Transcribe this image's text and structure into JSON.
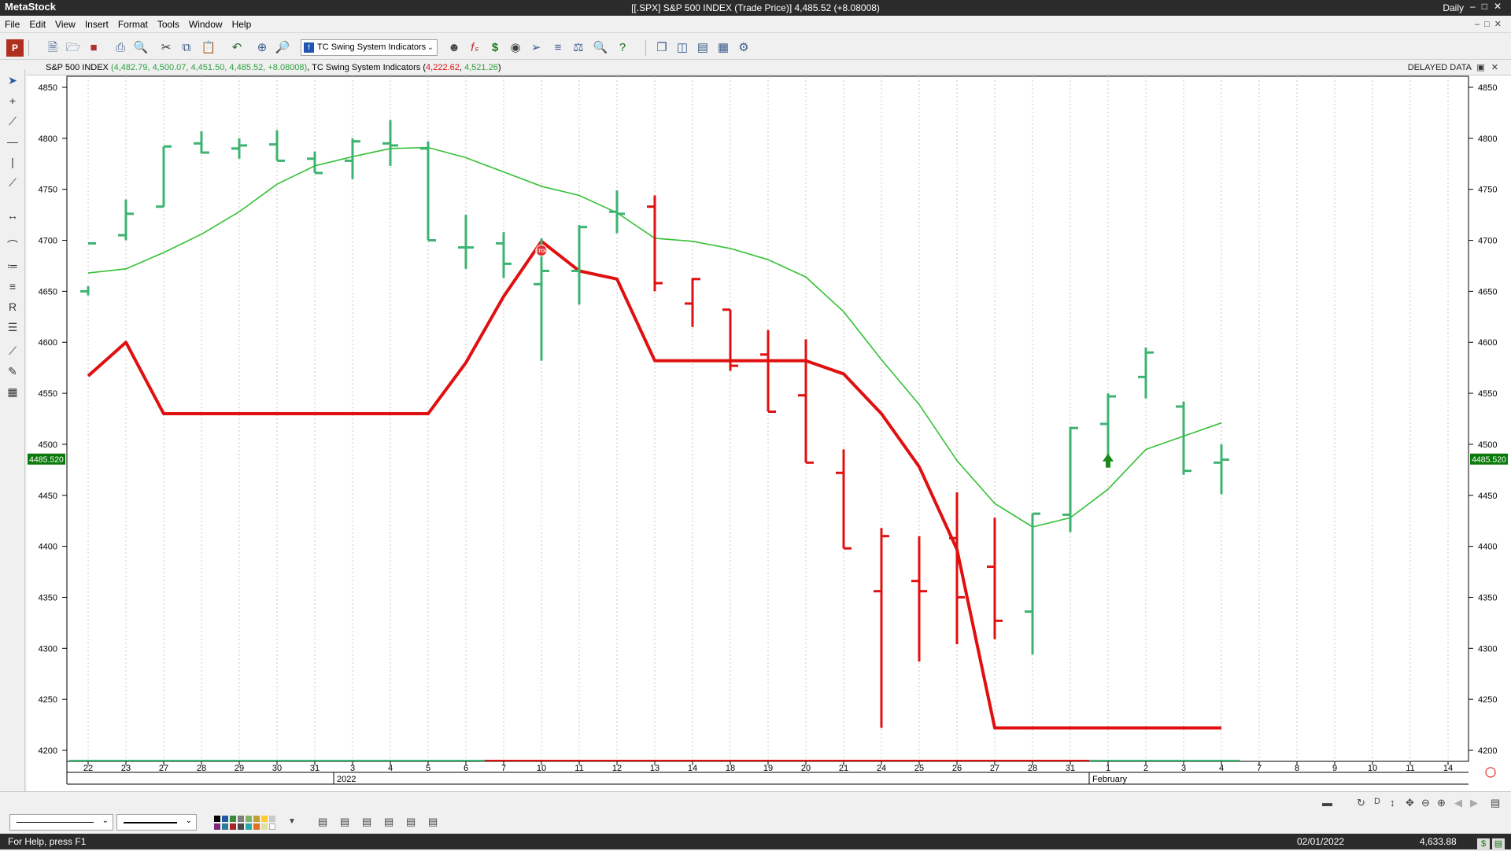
{
  "app": {
    "name": "MetaStock",
    "window_title": "[[.SPX] S&P 500 INDEX (Trade Price)]   4,485.52 (+8.08008)",
    "periodicity": "Daily"
  },
  "menu": [
    "File",
    "Edit",
    "View",
    "Insert",
    "Format",
    "Tools",
    "Window",
    "Help"
  ],
  "toolbar": {
    "indicator_selector": "TC Swing System Indicators",
    "icons": [
      "app-logo-icon",
      "new-icon",
      "open-icon",
      "close-icon",
      "print-icon",
      "print-preview-icon",
      "cut-icon",
      "copy-icon",
      "paste-icon",
      "undo-icon",
      "crosshair-icon",
      "zoom-icon",
      "expert-icon",
      "formula-icon",
      "dollar-icon",
      "binoculars-icon",
      "explorer-icon",
      "forecast-icon",
      "system-tester-icon",
      "search-icon",
      "help-icon",
      "cascade-icon",
      "tile-vertical-icon",
      "tile-horizontal-icon",
      "layout-icon",
      "settings-icon"
    ]
  },
  "chart_header": {
    "security": "S&P 500 INDEX",
    "security_values": "(4,482.79, 4,500.07, 4,451.50, 4,485.52, +8.08008)",
    "indicator": "TC Swing System Indicators",
    "indicator_val1": "4,222.62",
    "indicator_val2": "4,521.26",
    "delayed": "DELAYED DATA"
  },
  "statusbar": {
    "help": "For Help, press F1",
    "date": "02/01/2022",
    "value": "4,633.88"
  },
  "colors": {
    "up_bar": "#3cb371",
    "down_bar": "#e01010",
    "ma_line": "#34c134",
    "stop_line": "#e01010",
    "price_tag": "#0a7a0a"
  },
  "chart_data": {
    "type": "bar",
    "ylim": [
      4190,
      4860
    ],
    "y_ticks": [
      4200,
      4250,
      4300,
      4350,
      4400,
      4450,
      4500,
      4550,
      4600,
      4650,
      4700,
      4750,
      4800,
      4850
    ],
    "current_price_label": "4485.520",
    "x_labels": [
      "22",
      "23",
      "27",
      "28",
      "29",
      "30",
      "31",
      "3",
      "4",
      "5",
      "6",
      "7",
      "10",
      "11",
      "12",
      "13",
      "14",
      "18",
      "19",
      "20",
      "21",
      "24",
      "25",
      "26",
      "27",
      "28",
      "31",
      "1",
      "2",
      "3",
      "4",
      "7",
      "8",
      "9",
      "10",
      "11",
      "14"
    ],
    "x_group_labels": [
      {
        "label": "2022",
        "at_index": 7
      },
      {
        "label": "February",
        "at_index": 27
      }
    ],
    "ohlc": [
      {
        "o": 4650,
        "h": 4655,
        "l": 4646,
        "c": 4697
      },
      {
        "o": 4705,
        "h": 4740,
        "l": 4700,
        "c": 4726
      },
      {
        "o": 4733,
        "h": 4792,
        "l": 4733,
        "c": 4792
      },
      {
        "o": 4795,
        "h": 4807,
        "l": 4785,
        "c": 4786
      },
      {
        "o": 4790,
        "h": 4800,
        "l": 4780,
        "c": 4793
      },
      {
        "o": 4794,
        "h": 4808,
        "l": 4778,
        "c": 4778
      },
      {
        "o": 4780,
        "h": 4787,
        "l": 4766,
        "c": 4766
      },
      {
        "o": 4778,
        "h": 4800,
        "l": 4760,
        "c": 4797
      },
      {
        "o": 4795,
        "h": 4818,
        "l": 4773,
        "c": 4793
      },
      {
        "o": 4790,
        "h": 4797,
        "l": 4700,
        "c": 4700
      },
      {
        "o": 4693,
        "h": 4725,
        "l": 4672,
        "c": 4693
      },
      {
        "o": 4697,
        "h": 4708,
        "l": 4663,
        "c": 4677
      },
      {
        "o": 4657,
        "h": 4702,
        "l": 4582,
        "c": 4670
      },
      {
        "o": 4670,
        "h": 4715,
        "l": 4637,
        "c": 4713
      },
      {
        "o": 4728,
        "h": 4749,
        "l": 4707,
        "c": 4726
      },
      {
        "o": 4733,
        "h": 4744,
        "l": 4650,
        "c": 4658
      },
      {
        "o": 4638,
        "h": 4663,
        "l": 4615,
        "c": 4662
      },
      {
        "o": 4632,
        "h": 4632,
        "l": 4572,
        "c": 4577
      },
      {
        "o": 4588,
        "h": 4612,
        "l": 4532,
        "c": 4532
      },
      {
        "o": 4548,
        "h": 4603,
        "l": 4482,
        "c": 4482
      },
      {
        "o": 4472,
        "h": 4495,
        "l": 4398,
        "c": 4398
      },
      {
        "o": 4356,
        "h": 4418,
        "l": 4222,
        "c": 4410
      },
      {
        "o": 4366,
        "h": 4410,
        "l": 4287,
        "c": 4356
      },
      {
        "o": 4408,
        "h": 4453,
        "l": 4304,
        "c": 4350
      },
      {
        "o": 4380,
        "h": 4428,
        "l": 4309,
        "c": 4327
      },
      {
        "o": 4336,
        "h": 4432,
        "l": 4294,
        "c": 4432
      },
      {
        "o": 4431,
        "h": 4517,
        "l": 4414,
        "c": 4516
      },
      {
        "o": 4520,
        "h": 4550,
        "l": 4482,
        "c": 4547
      },
      {
        "o": 4566,
        "h": 4595,
        "l": 4545,
        "c": 4590
      },
      {
        "o": 4537,
        "h": 4542,
        "l": 4470,
        "c": 4474
      },
      {
        "o": 4482,
        "h": 4500,
        "l": 4451,
        "c": 4485
      }
    ],
    "moving_average": [
      4668,
      4672,
      4688,
      4706,
      4728,
      4755,
      4773,
      4782,
      4790,
      4791,
      4781,
      4767,
      4753,
      4744,
      4727,
      4702,
      4699,
      4692,
      4681,
      4664,
      4630,
      4583,
      4539,
      4484,
      4442,
      4419,
      4428,
      4456,
      4495,
      4508,
      4521
    ],
    "stop_line": [
      4567,
      4600,
      4530,
      4530,
      4530,
      4530,
      4530,
      4530,
      4530,
      4530,
      4580,
      4645,
      4699,
      4670,
      4662,
      4582,
      4582,
      4582,
      4582,
      4582,
      4569,
      4530,
      4478,
      4397,
      4222,
      4222,
      4222,
      4222,
      4222,
      4222,
      4222
    ],
    "signals": [
      {
        "type": "stop",
        "label": "STOP",
        "at_index": 12,
        "value": 4690
      },
      {
        "type": "buy-arrow",
        "at_index": 27,
        "value": 4474
      }
    ]
  }
}
